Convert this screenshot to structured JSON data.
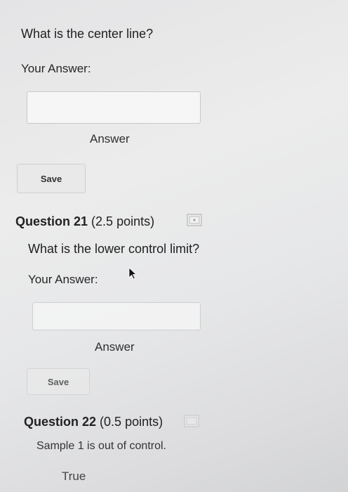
{
  "q20": {
    "text": "What is the center line?",
    "your_answer": "Your Answer:",
    "answer_value": "",
    "answer_caption": "Answer",
    "save": "Save"
  },
  "q21": {
    "title": "Question 21",
    "points": "(2.5 points)",
    "text": "What is the lower control limit?",
    "your_answer": "Your Answer:",
    "answer_value": "",
    "answer_caption": "Answer",
    "save": "Save"
  },
  "q22": {
    "title": "Question 22",
    "points": "(0.5 points)",
    "text": "Sample 1 is out of control.",
    "option_true": "True"
  },
  "icons": {
    "flag": "flag-icon",
    "cursor": "cursor-icon"
  }
}
